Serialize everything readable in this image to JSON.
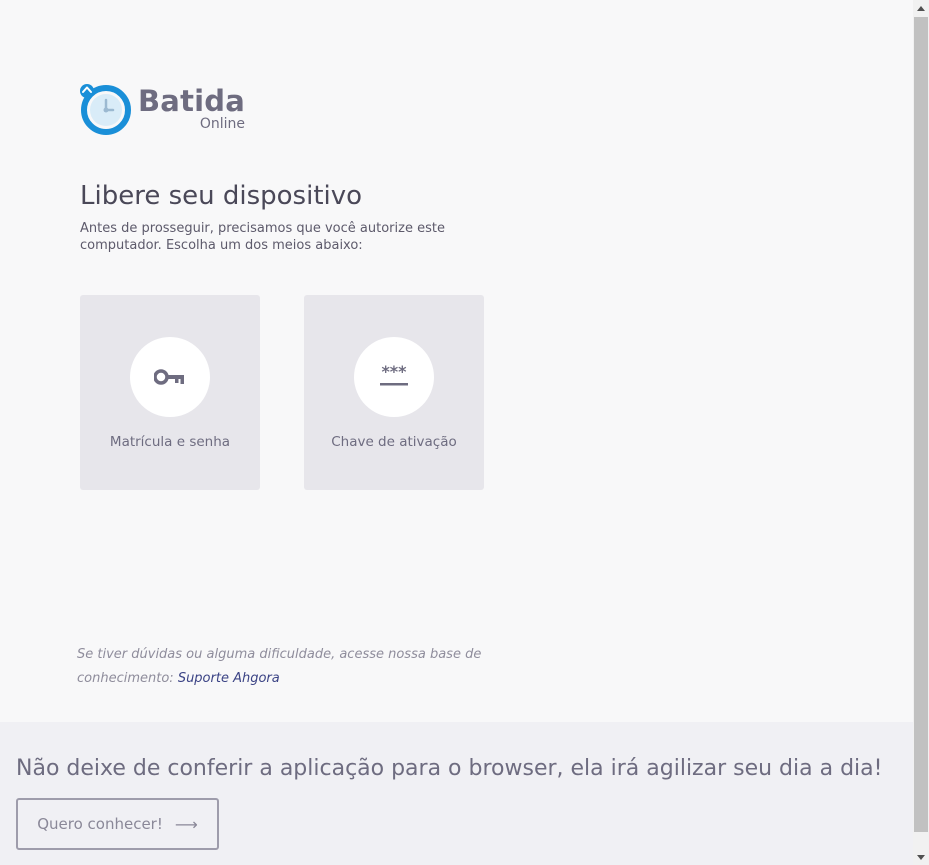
{
  "logo": {
    "name": "Batida",
    "sub": "Online"
  },
  "heading": {
    "title": "Libere seu dispositivo",
    "subtitle": "Antes de prosseguir, precisamos que você autorize este computador. Escolha um dos meios abaixo:"
  },
  "options": [
    {
      "label": "Matrícula e senha",
      "icon": "key-icon"
    },
    {
      "label": "Chave de ativação",
      "icon": "password-asterisks-icon"
    }
  ],
  "help": {
    "text": "Se tiver dúvidas ou alguma dificuldade, acesse nossa base de conhecimento: ",
    "link": "Suporte Ahgora"
  },
  "banner": {
    "text": "Não deixe de conferir a aplicação para o browser, ela irá agilizar seu dia a dia!",
    "button": "Quero conhecer!",
    "button_icon": "arrow-right-icon"
  },
  "colors": {
    "brand_blue": "#1a8fd8",
    "text_primary": "#4a4858",
    "card_bg": "#e7e6eb",
    "link": "#3b4385"
  }
}
